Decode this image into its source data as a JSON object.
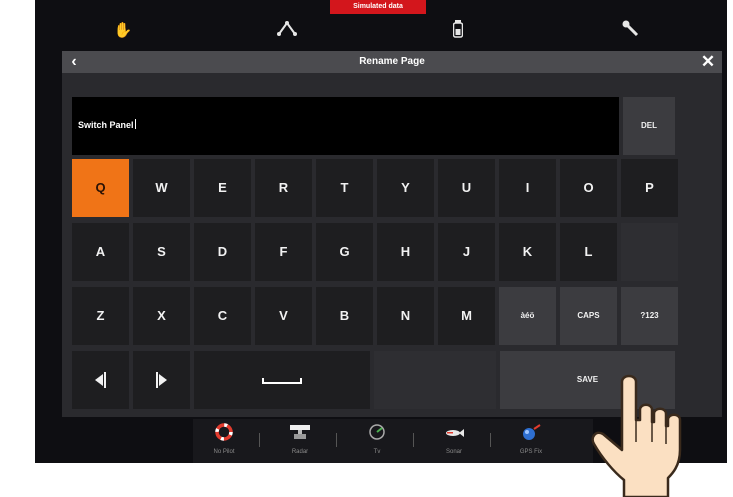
{
  "banner": "Simulated data",
  "top_icons": [
    "hand-icon",
    "route-icon",
    "tank-icon",
    "wrench-icon"
  ],
  "dialog": {
    "title": "Rename Page",
    "back": "‹",
    "close": "✕"
  },
  "input": {
    "value": "Switch Panel"
  },
  "keys": {
    "del": "DEL",
    "row1": [
      "Q",
      "W",
      "E",
      "R",
      "T",
      "Y",
      "U",
      "I",
      "O",
      "P"
    ],
    "row2": [
      "A",
      "S",
      "D",
      "F",
      "G",
      "H",
      "J",
      "K",
      "L"
    ],
    "row3": [
      "Z",
      "X",
      "C",
      "V",
      "B",
      "N",
      "M"
    ],
    "accents": "àéö",
    "caps": "CAPS",
    "symbols": "?123",
    "cursor_left": "◀│",
    "cursor_right": "│▶",
    "save": "SAVE"
  },
  "highlight_key": "Q",
  "taskbar": [
    {
      "label": "No Pilot",
      "icon": "lifebuoy-icon"
    },
    {
      "label": "Radar",
      "icon": "radar-icon"
    },
    {
      "label": "Tv",
      "icon": "gauge-icon"
    },
    {
      "label": "Sonar",
      "icon": "fish-icon"
    },
    {
      "label": "GPS Fix",
      "icon": "satellite-icon"
    }
  ],
  "colors": {
    "highlight": "#f07417",
    "banner": "#d3161c",
    "background": "#0e0e12"
  }
}
